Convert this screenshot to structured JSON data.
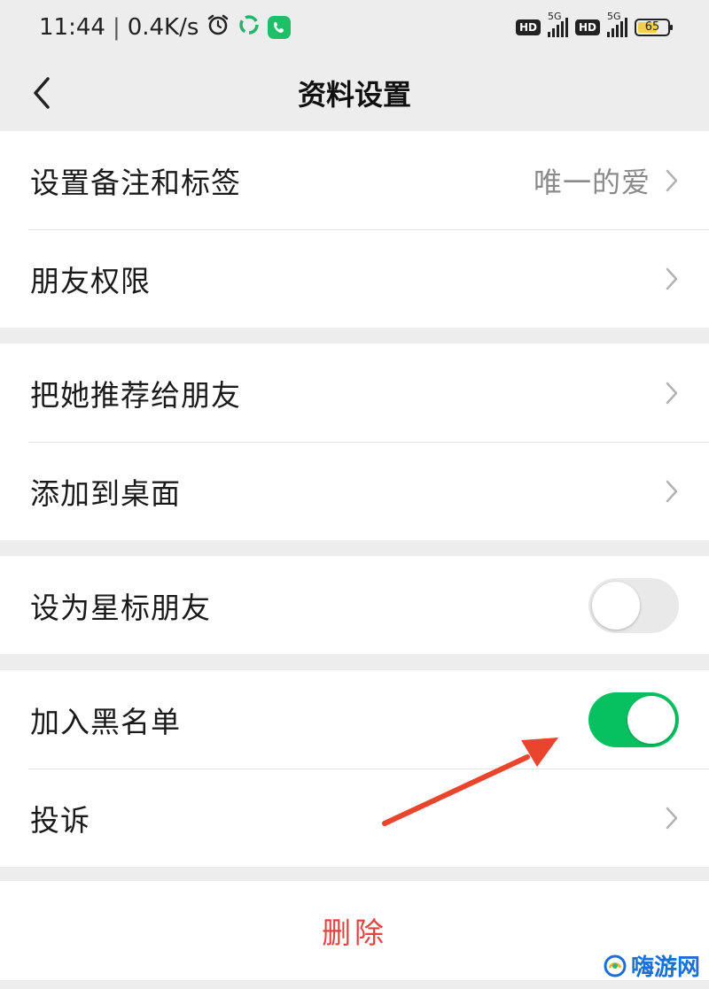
{
  "status_bar": {
    "time": "11:44",
    "net_speed": "0.4K/s",
    "sim1_hd": "HD",
    "sim1_net": "5G",
    "sim2_hd": "HD",
    "sim2_net": "5G",
    "battery": "65",
    "battery_level": 0.65,
    "icons": [
      "alarm-icon",
      "app-notification-icon",
      "phone-call-icon"
    ]
  },
  "nav": {
    "title": "资料设置",
    "back_icon": "chevron-left-icon"
  },
  "groups": [
    {
      "rows": [
        {
          "label": "设置备注和标签",
          "value": "唯一的爱",
          "control": "chevron"
        },
        {
          "label": "朋友权限",
          "control": "chevron"
        }
      ]
    },
    {
      "rows": [
        {
          "label": "把她推荐给朋友",
          "control": "chevron"
        },
        {
          "label": "添加到桌面",
          "control": "chevron"
        }
      ]
    },
    {
      "rows": [
        {
          "label": "设为星标朋友",
          "control": "toggle",
          "checked": false
        }
      ]
    },
    {
      "rows": [
        {
          "label": "加入黑名单",
          "control": "toggle",
          "checked": true
        },
        {
          "label": "投诉",
          "control": "chevron"
        }
      ]
    }
  ],
  "delete_label": "删除",
  "watermark": "嗨游网",
  "colors": {
    "accent_green": "#07c160",
    "danger_red": "#e64340",
    "annotation_arrow": "#e8452c",
    "background": "#ededed"
  }
}
